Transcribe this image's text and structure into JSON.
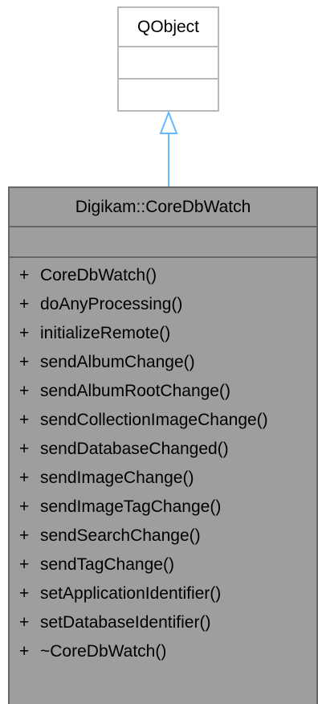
{
  "parent_class": {
    "name": "QObject"
  },
  "class": {
    "name": "Digikam::CoreDbWatch",
    "methods": [
      {
        "visibility": "+",
        "name": "CoreDbWatch()"
      },
      {
        "visibility": "+",
        "name": "doAnyProcessing()"
      },
      {
        "visibility": "+",
        "name": "initializeRemote()"
      },
      {
        "visibility": "+",
        "name": "sendAlbumChange()"
      },
      {
        "visibility": "+",
        "name": "sendAlbumRootChange()"
      },
      {
        "visibility": "+",
        "name": "sendCollectionImageChange()"
      },
      {
        "visibility": "+",
        "name": "sendDatabaseChanged()"
      },
      {
        "visibility": "+",
        "name": "sendImageChange()"
      },
      {
        "visibility": "+",
        "name": "sendImageTagChange()"
      },
      {
        "visibility": "+",
        "name": "sendSearchChange()"
      },
      {
        "visibility": "+",
        "name": "sendTagChange()"
      },
      {
        "visibility": "+",
        "name": "setApplicationIdentifier()"
      },
      {
        "visibility": "+",
        "name": "setDatabaseIdentifier()"
      },
      {
        "visibility": "+",
        "name": "~CoreDbWatch()"
      }
    ]
  },
  "colors": {
    "inheritance_arrow": "#63b8ff",
    "class_fill": "#9e9e9e",
    "class_border": "#666666",
    "parent_border": "#b8b8b8"
  }
}
